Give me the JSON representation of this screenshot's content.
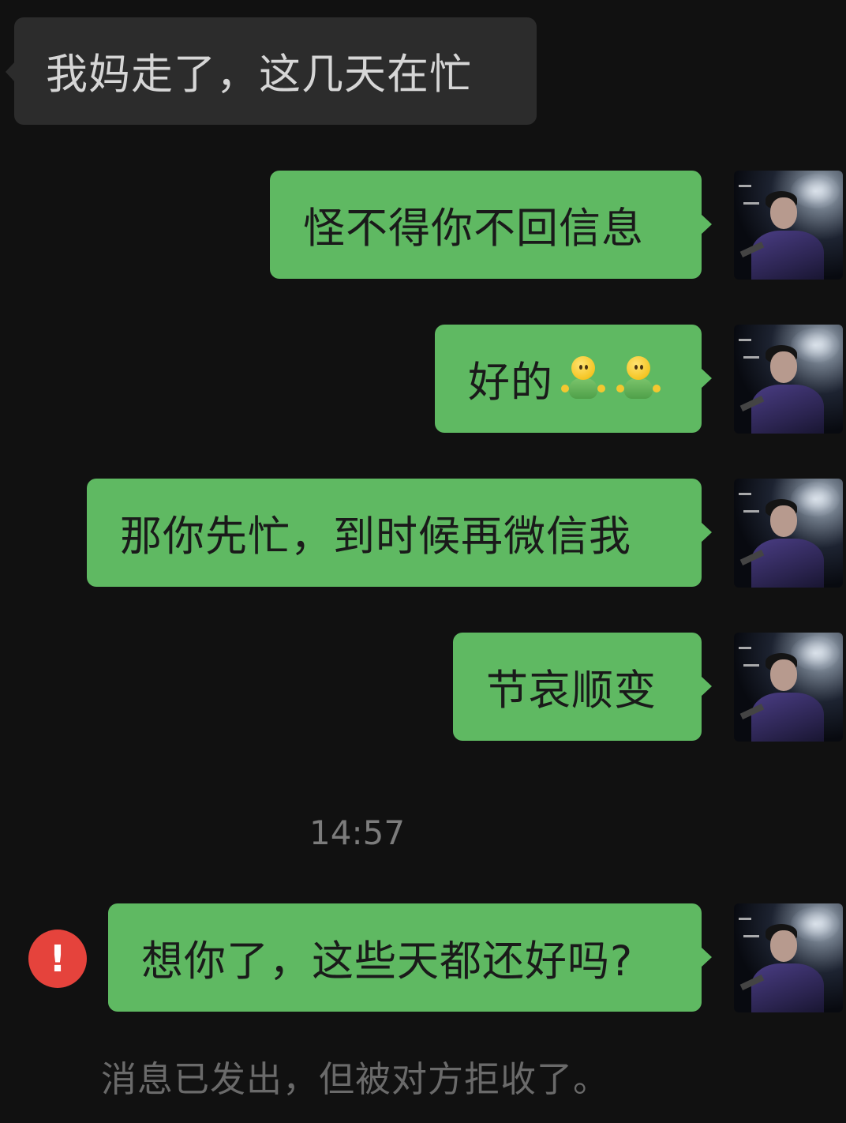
{
  "conversation": {
    "messages": [
      {
        "direction": "incoming",
        "text": "我妈走了，这几天在忙"
      },
      {
        "direction": "outgoing",
        "text": "怪不得你不回信息"
      },
      {
        "direction": "outgoing",
        "text": "好的",
        "emojis": [
          "green-person-emoji",
          "green-person-emoji"
        ]
      },
      {
        "direction": "outgoing",
        "text": "那你先忙，到时候再微信我"
      },
      {
        "direction": "outgoing",
        "text": "节哀顺变"
      },
      {
        "direction": "outgoing",
        "text": "想你了，这些天都还好吗?",
        "status": "failed"
      }
    ],
    "timestamp": "14:57",
    "error_icon_glyph": "!",
    "system_note": "消息已发出，但被对方拒收了。"
  },
  "theme": {
    "background": "#111111",
    "incoming_bubble": "#2c2c2c",
    "outgoing_bubble": "#5fb962",
    "error_color": "#e5433c"
  }
}
